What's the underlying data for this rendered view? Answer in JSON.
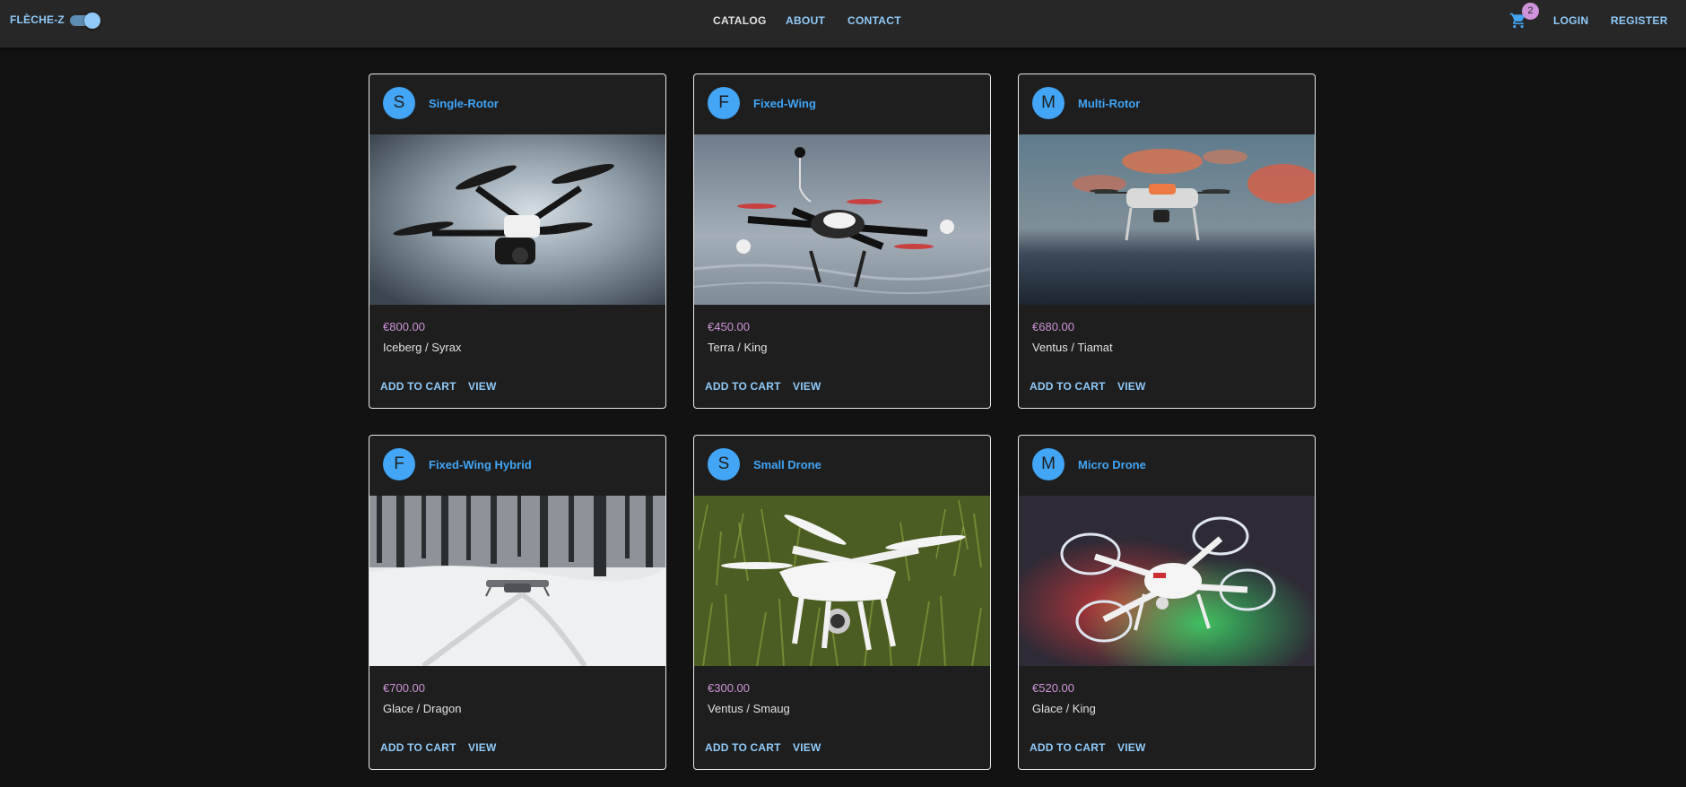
{
  "header": {
    "brand": "FLÈCHE-Z",
    "nav": [
      "CATALOG",
      "ABOUT",
      "CONTACT"
    ],
    "cart_count": "2",
    "login": "LOGIN",
    "register": "REGISTER",
    "theme_toggle_on": true
  },
  "colors": {
    "accent": "#42a5f5",
    "link": "#90caf9",
    "price": "#ce93d8",
    "background": "#121212",
    "card": "#1e1e1e"
  },
  "products": [
    {
      "initial": "S",
      "title": "Single-Rotor",
      "price": "€800.00",
      "vendor": "Iceberg / Syrax",
      "add": "ADD TO CART",
      "view": "VIEW",
      "image": "black drone in grey sky"
    },
    {
      "initial": "F",
      "title": "Fixed-Wing",
      "price": "€450.00",
      "vendor": "Terra / King",
      "add": "ADD TO CART",
      "view": "VIEW",
      "image": "quadcopter on water"
    },
    {
      "initial": "M",
      "title": "Multi-Rotor",
      "price": "€680.00",
      "vendor": "Ventus / Tiamat",
      "add": "ADD TO CART",
      "view": "VIEW",
      "image": "drone at sunset"
    },
    {
      "initial": "F",
      "title": "Fixed-Wing Hybrid",
      "price": "€700.00",
      "vendor": "Glace / Dragon",
      "add": "ADD TO CART",
      "view": "VIEW",
      "image": "drone in snowy forest"
    },
    {
      "initial": "S",
      "title": "Small Drone",
      "price": "€300.00",
      "vendor": "Ventus / Smaug",
      "add": "ADD TO CART",
      "view": "VIEW",
      "image": "white drone on grass"
    },
    {
      "initial": "M",
      "title": "Micro Drone",
      "price": "€520.00",
      "vendor": "Glace / King",
      "add": "ADD TO CART",
      "view": "VIEW",
      "image": "white drone with lights"
    }
  ]
}
